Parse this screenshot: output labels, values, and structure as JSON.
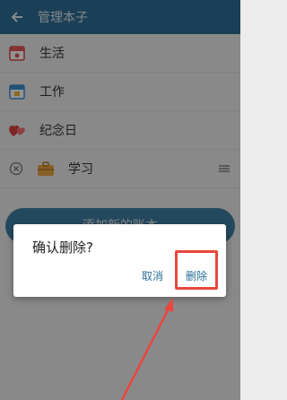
{
  "appbar": {
    "title": "管理本子"
  },
  "rows": [
    {
      "label": "生活"
    },
    {
      "label": "工作"
    },
    {
      "label": "纪念日"
    },
    {
      "label": "学习"
    }
  ],
  "add_button": {
    "label": "添加新的账本"
  },
  "dialog": {
    "title": "确认删除?",
    "cancel_label": "取消",
    "delete_label": "删除"
  },
  "colors": {
    "appbar": "#2f6d94",
    "accent_text": "#2a6f96",
    "annotation": "#e8473d"
  }
}
